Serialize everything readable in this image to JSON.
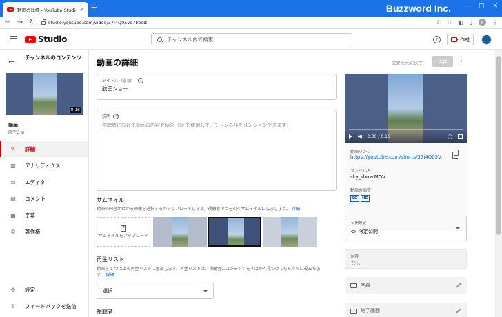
{
  "browser": {
    "tab_title": "動画の詳細 - YouTube Studio",
    "tab_close": "×",
    "new_tab": "+",
    "brand": "Buzzword Inc.",
    "win_min": "—",
    "win_max": "□",
    "win_close": "✕",
    "url": "studio.youtube.com/video/37i4Q05Vc7I/edit",
    "profile_initials": "JP"
  },
  "header": {
    "logo_text": "Studio",
    "search_placeholder": "チャンネル内で検索",
    "help": "?",
    "create_label": "作成"
  },
  "sidebar": {
    "back": "←",
    "title": "チャンネルのコンテンツ",
    "thumb_duration": "0:16",
    "video_label": "動画",
    "video_name": "航空ショー",
    "items": [
      {
        "label": "詳細",
        "icon": "✎"
      },
      {
        "label": "アナリティクス",
        "icon": "▥"
      },
      {
        "label": "エディタ",
        "icon": "▭"
      },
      {
        "label": "コメント",
        "icon": "▤"
      },
      {
        "label": "字幕",
        "icon": "▦"
      },
      {
        "label": "著作権",
        "icon": "©"
      }
    ],
    "bottom": [
      {
        "label": "設定",
        "icon": "⚙"
      },
      {
        "label": "フィードバックを送信",
        "icon": "!"
      }
    ]
  },
  "main": {
    "page_title": "動画の詳細",
    "undo_label": "変更を元に戻す",
    "save_label": "保存",
    "more": "⋮",
    "title_field": {
      "label": "タイトル（必須）",
      "value": "航空ショー"
    },
    "desc_field": {
      "label": "説明",
      "placeholder": "視聴者に向けて動画の内容を紹介（@ を使用して、チャンネルをメンションできます）"
    },
    "thumbnail": {
      "title": "サムネイル",
      "desc": "動画の内容がわかる画像を選択するかアップロードします。視聴者の目を引くサムネイルにしましょう。",
      "link": "詳細",
      "upload_label": "サムネイルをアップロード"
    },
    "playlist": {
      "title": "再生リスト",
      "desc": "動画を 1 つ以上の再生リストに追加します。再生リストは、視聴者にコンテンツをすばやく見つけてもらうのに役立ちます。",
      "link": "詳細",
      "select_value": "選択"
    },
    "audience_title": "視聴者"
  },
  "preview": {
    "time": "0:00 / 0:16",
    "link_label": "動画リンク",
    "link": "https://youtube.com/shorts/37i4Q05V...",
    "file_label": "ファイル名",
    "file_name": "sky_show.MOV",
    "quality_label": "動画の画質",
    "quality": [
      "SD",
      "HD"
    ]
  },
  "settings": {
    "visibility_label": "公開設定",
    "visibility_value": "限定公開",
    "restriction_label": "制限",
    "restriction_value": "なし",
    "subtitles_label": "字幕",
    "end_screen_label": "終了画面"
  }
}
